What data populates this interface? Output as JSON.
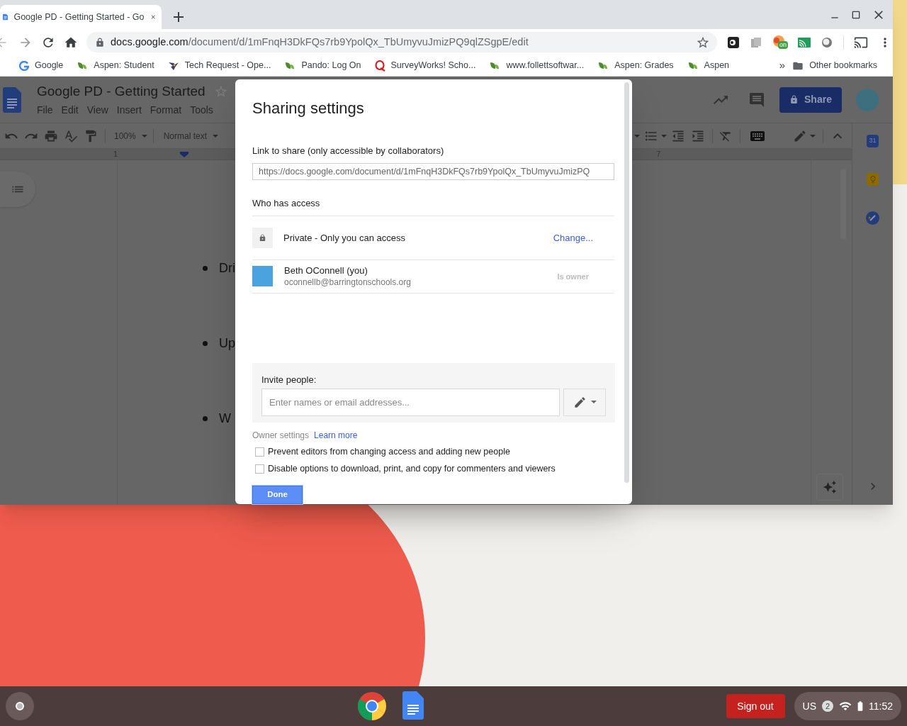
{
  "browser": {
    "tabs": [
      {
        "title": "Google PD - Getting Started - Go",
        "selected": true
      }
    ],
    "url": {
      "host": "docs.google.com",
      "path": "/document/d/1mFnqH3DkFQs7rb9YpolQx_TbUmyvuJmizPQ9qlZSgpE/edit"
    },
    "extension_badge": "on",
    "bookmarks": [
      {
        "label": "Google",
        "kind": "google"
      },
      {
        "label": "Aspen: Student",
        "kind": "leaf"
      },
      {
        "label": "Tech Request - Ope...",
        "kind": "eagle"
      },
      {
        "label": "Pando: Log On",
        "kind": "leaf"
      },
      {
        "label": "SurveyWorks! Scho...",
        "kind": "q"
      },
      {
        "label": "www.follettsoftwar...",
        "kind": "leaf"
      },
      {
        "label": "Aspen: Grades",
        "kind": "leaf"
      },
      {
        "label": "Aspen",
        "kind": "leaf"
      }
    ],
    "more_bookmarks": "»",
    "other_bookmarks": "Other bookmarks"
  },
  "document": {
    "title": "Google PD - Getting Started",
    "menus": [
      "File",
      "Edit",
      "View",
      "Insert",
      "Format",
      "Tools"
    ],
    "zoom": "100%",
    "style": "Normal text",
    "ruler_marks": [
      "1",
      "7"
    ],
    "share_button": "Share",
    "calendar_day": "31",
    "bullets": [
      "Dri",
      "Up",
      "W"
    ]
  },
  "dialog": {
    "title": "Sharing settings",
    "link_label": "Link to share (only accessible by collaborators)",
    "link_value": "https://docs.google.com/document/d/1mFnqH3DkFQs7rb9YpolQx_TbUmyvuJmizPQ",
    "access_label": "Who has access",
    "visibility": {
      "text": "Private - Only you can access",
      "action": "Change..."
    },
    "people": [
      {
        "name": "Beth OConnell (you)",
        "email": "oconnellb@barringtonschools.org",
        "role": "Is owner"
      }
    ],
    "invite_label": "Invite people:",
    "invite_placeholder": "Enter names or email addresses...",
    "owner_settings": "Owner settings",
    "learn_more": "Learn more",
    "options": [
      {
        "label": "Prevent editors from changing access and adding new people",
        "checked": false
      },
      {
        "label": "Disable options to download, print, and copy for commenters and viewers",
        "checked": false
      }
    ],
    "done_button": "Done"
  },
  "shelf": {
    "sign_out": "Sign out",
    "ime": "US",
    "notifications": "2",
    "time": "11:52"
  }
}
